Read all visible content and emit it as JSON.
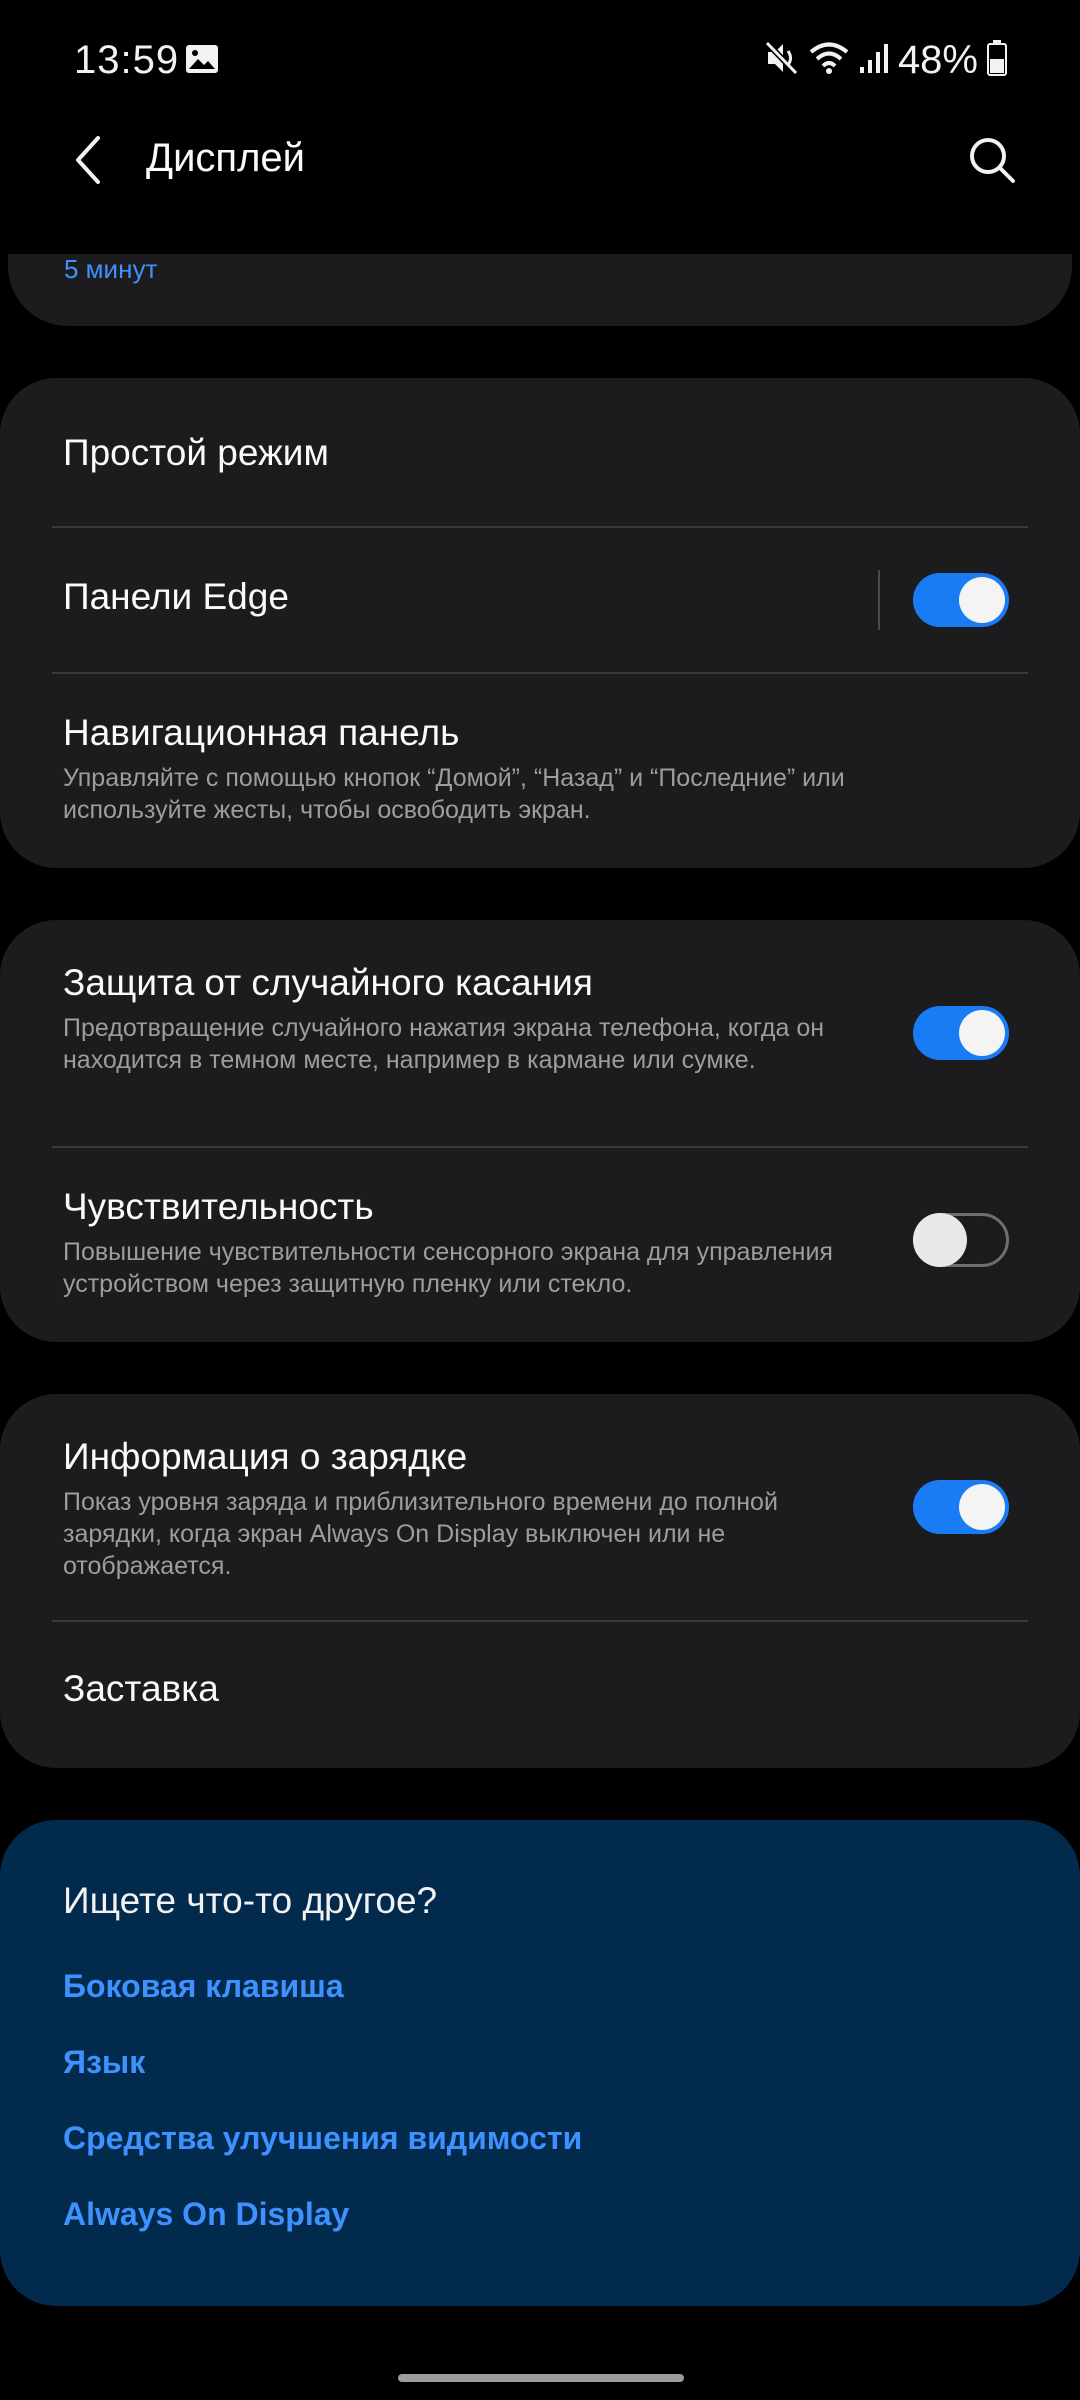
{
  "status_bar": {
    "time": "13:59",
    "battery": "48%",
    "icons": [
      "image-icon",
      "mute-icon",
      "wifi-icon",
      "signal-icon",
      "battery-icon"
    ]
  },
  "header": {
    "title": "Дисплей",
    "back_icon": "chevron-left-icon",
    "search_icon": "search-icon"
  },
  "partial_item": {
    "value": "5 минут"
  },
  "group1": {
    "easy_mode": {
      "title": "Простой режим"
    },
    "edge_panels": {
      "title": "Панели Edge",
      "enabled": true
    },
    "nav_bar": {
      "title": "Навигационная панель",
      "subtitle": "Управляйте с помощью кнопок “Домой”, “Назад” и “Последние” или используйте жесты, чтобы освободить экран."
    }
  },
  "group2": {
    "accidental_touch": {
      "title": "Защита от случайного касания",
      "subtitle": "Предотвращение случайного нажатия экрана телефона, когда он находится в темном месте, например в кармане или сумке.",
      "enabled": true
    },
    "sensitivity": {
      "title": "Чувствительность",
      "subtitle": "Повышение чувствительности сенсорного экрана для управления устройством через защитную пленку или стекло.",
      "enabled": false
    }
  },
  "group3": {
    "charging_info": {
      "title": "Информация о зарядке",
      "subtitle": "Показ уровня заряда и приблизительного времени до полной зарядки, когда экран Always On Display выключен или не отображается.",
      "enabled": true
    },
    "screensaver": {
      "title": "Заставка"
    }
  },
  "related": {
    "title": "Ищете что-то другое?",
    "links": [
      "Боковая клавиша",
      "Язык",
      "Средства улучшения видимости",
      "Always On Display"
    ]
  },
  "colors": {
    "background": "#000000",
    "card": "#1c1c1e",
    "accent": "#1a7cf5",
    "link": "#3e91ff",
    "related_bg": "#022a4d"
  }
}
